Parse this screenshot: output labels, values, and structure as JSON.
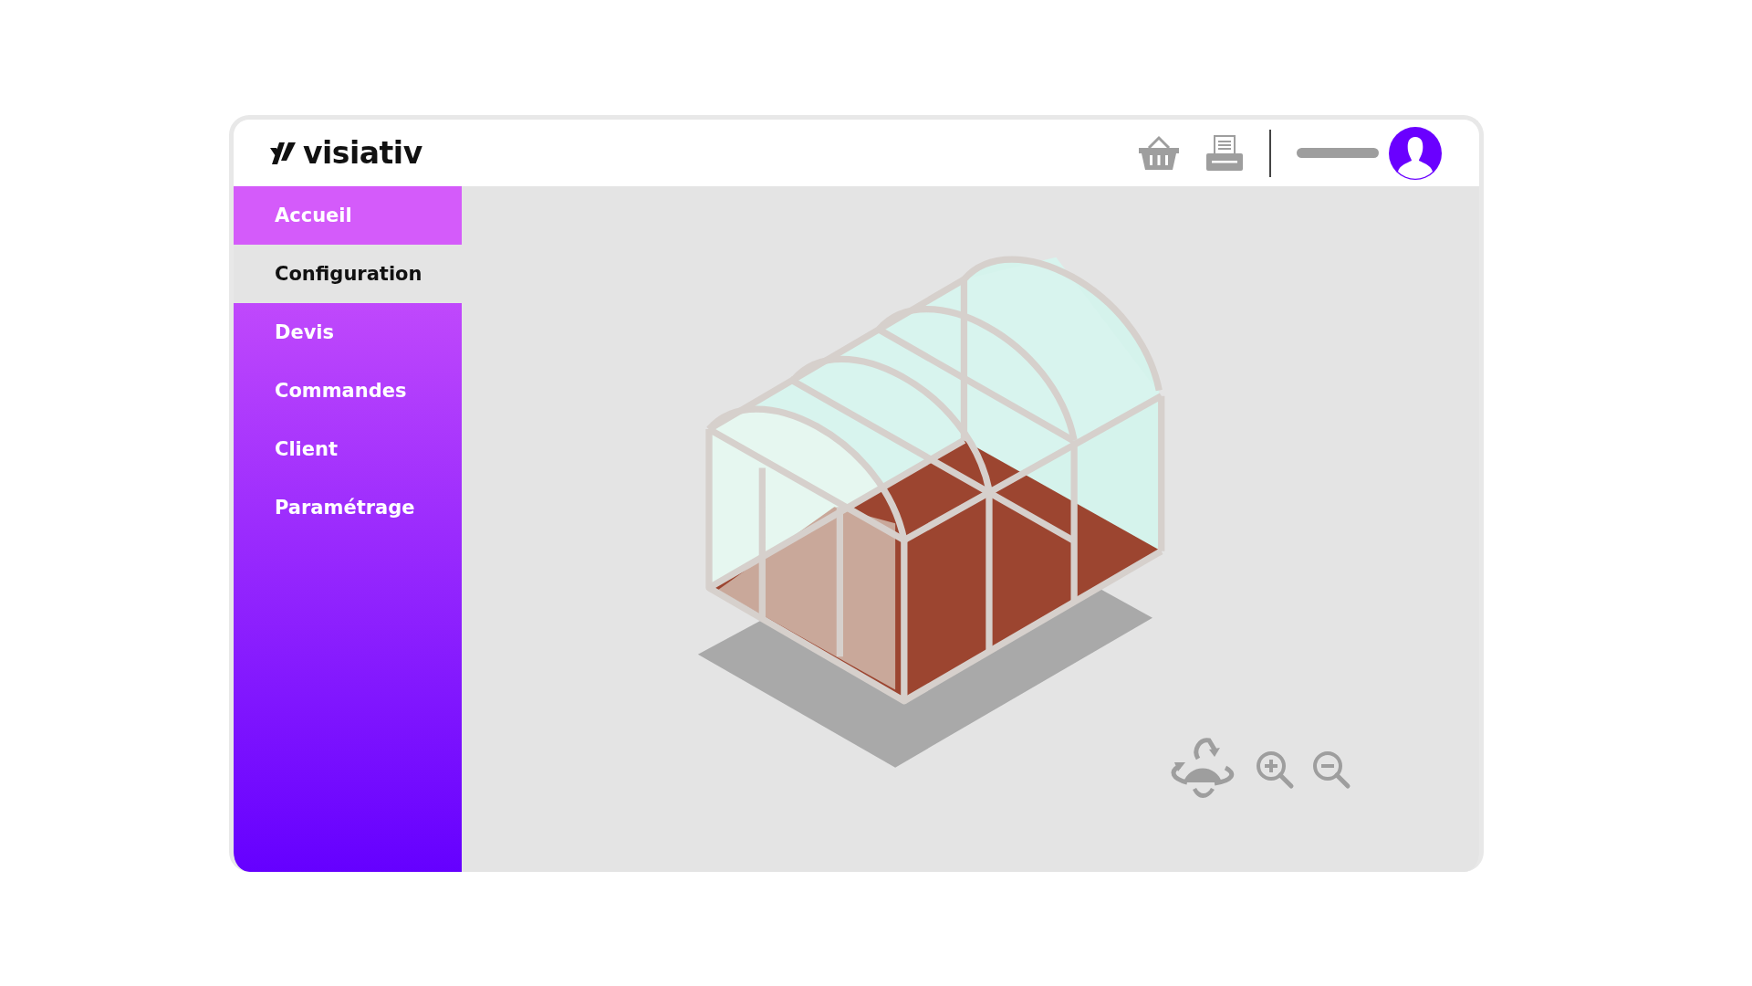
{
  "header": {
    "logo": "visiativ"
  },
  "sidebar": {
    "items": [
      {
        "label": "Accueil",
        "selected": false,
        "highlighted": true
      },
      {
        "label": "Configuration",
        "selected": true,
        "highlighted": false
      },
      {
        "label": "Devis",
        "selected": false,
        "highlighted": false
      },
      {
        "label": "Commandes",
        "selected": false,
        "highlighted": false
      },
      {
        "label": "Client",
        "selected": false,
        "highlighted": false
      },
      {
        "label": "Paramétrage",
        "selected": false,
        "highlighted": false
      }
    ]
  }
}
